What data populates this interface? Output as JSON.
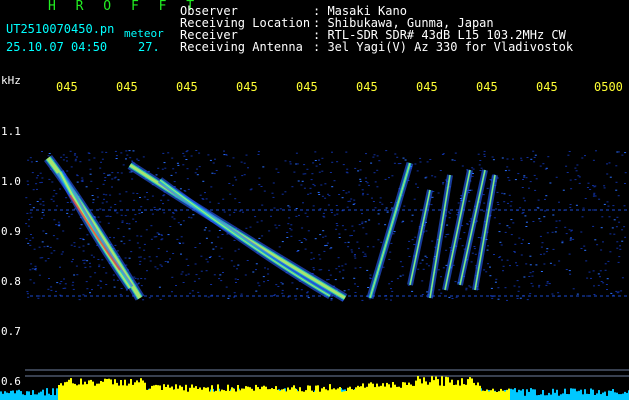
{
  "header": {
    "app_name": "H R O F F T",
    "file_name": "UT2510070450.pn",
    "mode": "meteor",
    "datetime": "25.10.07 04:50",
    "count": "27.",
    "fields": [
      {
        "label": "Observer",
        "value": ": Masaki Kano"
      },
      {
        "label": "Receiving Location",
        "value": ": Shibukawa, Gunma, Japan"
      },
      {
        "label": "Receiver",
        "value": ": RTL-SDR SDR# 43dB L15 103.2MHz CW"
      },
      {
        "label": "Receiving Antenna",
        "value": ": 3el Yagi(V) Az 330 for Vladivostok"
      }
    ]
  },
  "axis": {
    "unit": "kHz",
    "time_ticks": [
      "045",
      "045",
      "045",
      "045",
      "045",
      "045",
      "045",
      "045",
      "045",
      "0500"
    ],
    "freq_ticks": [
      "1.1",
      "1.0",
      "0.9",
      "0.8",
      "0.7",
      "0.6"
    ]
  },
  "colors": {
    "background": "#000000",
    "noise": "#1030a0",
    "trace_hot": "#ff3030",
    "trace_mid": "#ffff40",
    "level_bar": "#ffff00",
    "level_base": "#00c8ff"
  }
}
